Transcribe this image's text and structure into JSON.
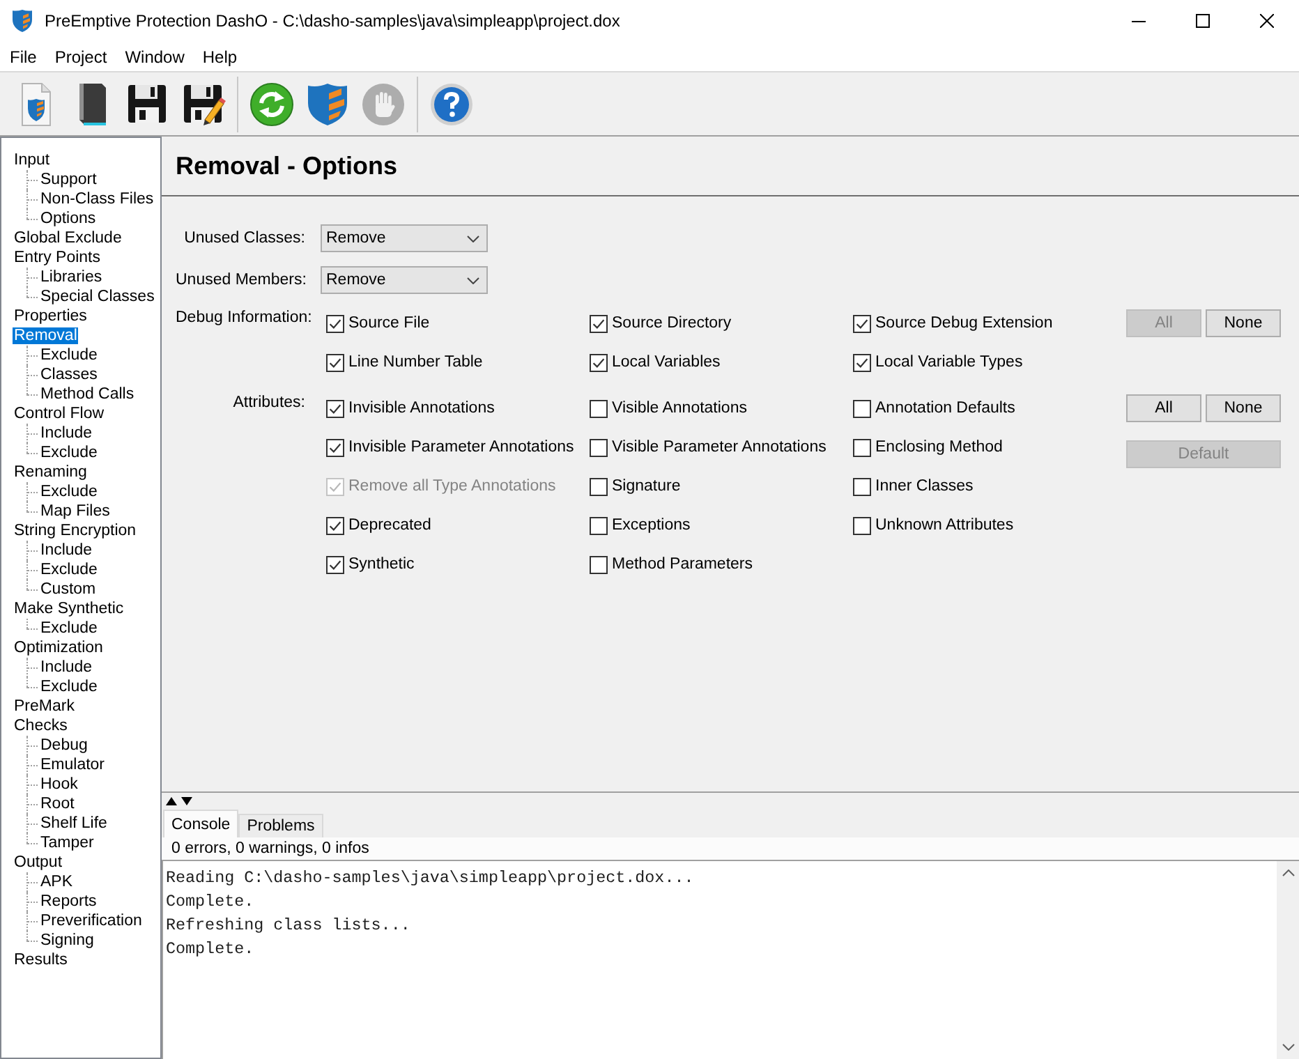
{
  "window": {
    "title": "PreEmptive Protection DashO - C:\\dasho-samples\\java\\simpleapp\\project.dox"
  },
  "menu": [
    {
      "label": "File"
    },
    {
      "label": "Project"
    },
    {
      "label": "Window"
    },
    {
      "label": "Help"
    }
  ],
  "toolbar": [
    [
      {
        "kind": "new",
        "disabled": false
      },
      {
        "kind": "open",
        "disabled": false
      },
      {
        "kind": "save",
        "disabled": false
      },
      {
        "kind": "save-as",
        "disabled": false
      }
    ],
    [
      {
        "kind": "refresh",
        "disabled": false
      },
      {
        "kind": "protect",
        "disabled": false
      },
      {
        "kind": "stop",
        "disabled": true
      }
    ],
    [
      {
        "kind": "help",
        "disabled": false
      }
    ]
  ],
  "sidebar": {
    "items": [
      {
        "label": "Input",
        "selected": false,
        "children": [
          {
            "label": "Support",
            "selected": false
          },
          {
            "label": "Non-Class Files",
            "selected": false
          },
          {
            "label": "Options",
            "selected": false
          }
        ]
      },
      {
        "label": "Global Exclude",
        "selected": false
      },
      {
        "label": "Entry Points",
        "selected": false,
        "children": [
          {
            "label": "Libraries",
            "selected": false
          },
          {
            "label": "Special Classes",
            "selected": false
          }
        ]
      },
      {
        "label": "Properties",
        "selected": false
      },
      {
        "label": "Removal",
        "selected": true,
        "children": [
          {
            "label": "Exclude",
            "selected": false
          },
          {
            "label": "Classes",
            "selected": false
          },
          {
            "label": "Method Calls",
            "selected": false
          }
        ]
      },
      {
        "label": "Control Flow",
        "selected": false,
        "children": [
          {
            "label": "Include",
            "selected": false
          },
          {
            "label": "Exclude",
            "selected": false
          }
        ]
      },
      {
        "label": "Renaming",
        "selected": false,
        "children": [
          {
            "label": "Exclude",
            "selected": false
          },
          {
            "label": "Map Files",
            "selected": false
          }
        ]
      },
      {
        "label": "String Encryption",
        "selected": false,
        "children": [
          {
            "label": "Include",
            "selected": false
          },
          {
            "label": "Exclude",
            "selected": false
          },
          {
            "label": "Custom",
            "selected": false
          }
        ]
      },
      {
        "label": "Make Synthetic",
        "selected": false,
        "children": [
          {
            "label": "Exclude",
            "selected": false
          }
        ]
      },
      {
        "label": "Optimization",
        "selected": false,
        "children": [
          {
            "label": "Include",
            "selected": false
          },
          {
            "label": "Exclude",
            "selected": false
          }
        ]
      },
      {
        "label": "PreMark",
        "selected": false
      },
      {
        "label": "Checks",
        "selected": false,
        "children": [
          {
            "label": "Debug",
            "selected": false
          },
          {
            "label": "Emulator",
            "selected": false
          },
          {
            "label": "Hook",
            "selected": false
          },
          {
            "label": "Root",
            "selected": false
          },
          {
            "label": "Shelf Life",
            "selected": false
          },
          {
            "label": "Tamper",
            "selected": false
          }
        ]
      },
      {
        "label": "Output",
        "selected": false,
        "children": [
          {
            "label": "APK",
            "selected": false
          },
          {
            "label": "Reports",
            "selected": false
          },
          {
            "label": "Preverification",
            "selected": false
          },
          {
            "label": "Signing",
            "selected": false
          }
        ]
      },
      {
        "label": "Results",
        "selected": false
      }
    ]
  },
  "page": {
    "title": "Removal - Options",
    "dropdowns": [
      {
        "label": "Unused Classes:",
        "value": "Remove"
      },
      {
        "label": "Unused Members:",
        "value": "Remove"
      }
    ],
    "sections": [
      {
        "label": "Debug Information:",
        "checkboxes": [
          {
            "label": "Source File",
            "checked": true,
            "disabled": false
          },
          {
            "label": "Source Directory",
            "checked": true,
            "disabled": false
          },
          {
            "label": "Source Debug Extension",
            "checked": true,
            "disabled": false
          },
          {
            "label": "Line Number Table",
            "checked": true,
            "disabled": false
          },
          {
            "label": "Local Variables",
            "checked": true,
            "disabled": false
          },
          {
            "label": "Local Variable Types",
            "checked": true,
            "disabled": false
          }
        ],
        "button_rows": [
          [
            {
              "label": "All",
              "disabled": true
            },
            {
              "label": "None",
              "disabled": false
            }
          ]
        ]
      },
      {
        "label": "Attributes:",
        "checkboxes": [
          {
            "label": "Invisible Annotations",
            "checked": true,
            "disabled": false
          },
          {
            "label": "Visible Annotations",
            "checked": false,
            "disabled": false
          },
          {
            "label": "Annotation Defaults",
            "checked": false,
            "disabled": false
          },
          {
            "label": "Invisible Parameter Annotations",
            "checked": true,
            "disabled": false
          },
          {
            "label": "Visible Parameter Annotations",
            "checked": false,
            "disabled": false
          },
          {
            "label": "Enclosing Method",
            "checked": false,
            "disabled": false
          },
          {
            "label": "Remove all Type Annotations",
            "checked": true,
            "disabled": true
          },
          {
            "label": "Signature",
            "checked": false,
            "disabled": false
          },
          {
            "label": "Inner Classes",
            "checked": false,
            "disabled": false
          },
          {
            "label": "Deprecated",
            "checked": true,
            "disabled": false
          },
          {
            "label": "Exceptions",
            "checked": false,
            "disabled": false
          },
          {
            "label": "Unknown Attributes",
            "checked": false,
            "disabled": false
          },
          {
            "label": "Synthetic",
            "checked": true,
            "disabled": false
          },
          {
            "label": "Method Parameters",
            "checked": false,
            "disabled": false
          }
        ],
        "button_rows": [
          [
            {
              "label": "All",
              "disabled": false
            },
            {
              "label": "None",
              "disabled": false
            }
          ],
          [
            {
              "label": "Default",
              "disabled": true
            }
          ]
        ]
      }
    ]
  },
  "console": {
    "tabs": [
      {
        "label": "Console",
        "selected": true
      },
      {
        "label": "Problems",
        "selected": false
      }
    ],
    "summary": "0 errors, 0 warnings, 0 infos",
    "lines": [
      "Reading C:\\dasho-samples\\java\\simpleapp\\project.dox...",
      "Complete.",
      "Refreshing class lists...",
      "Complete."
    ]
  }
}
